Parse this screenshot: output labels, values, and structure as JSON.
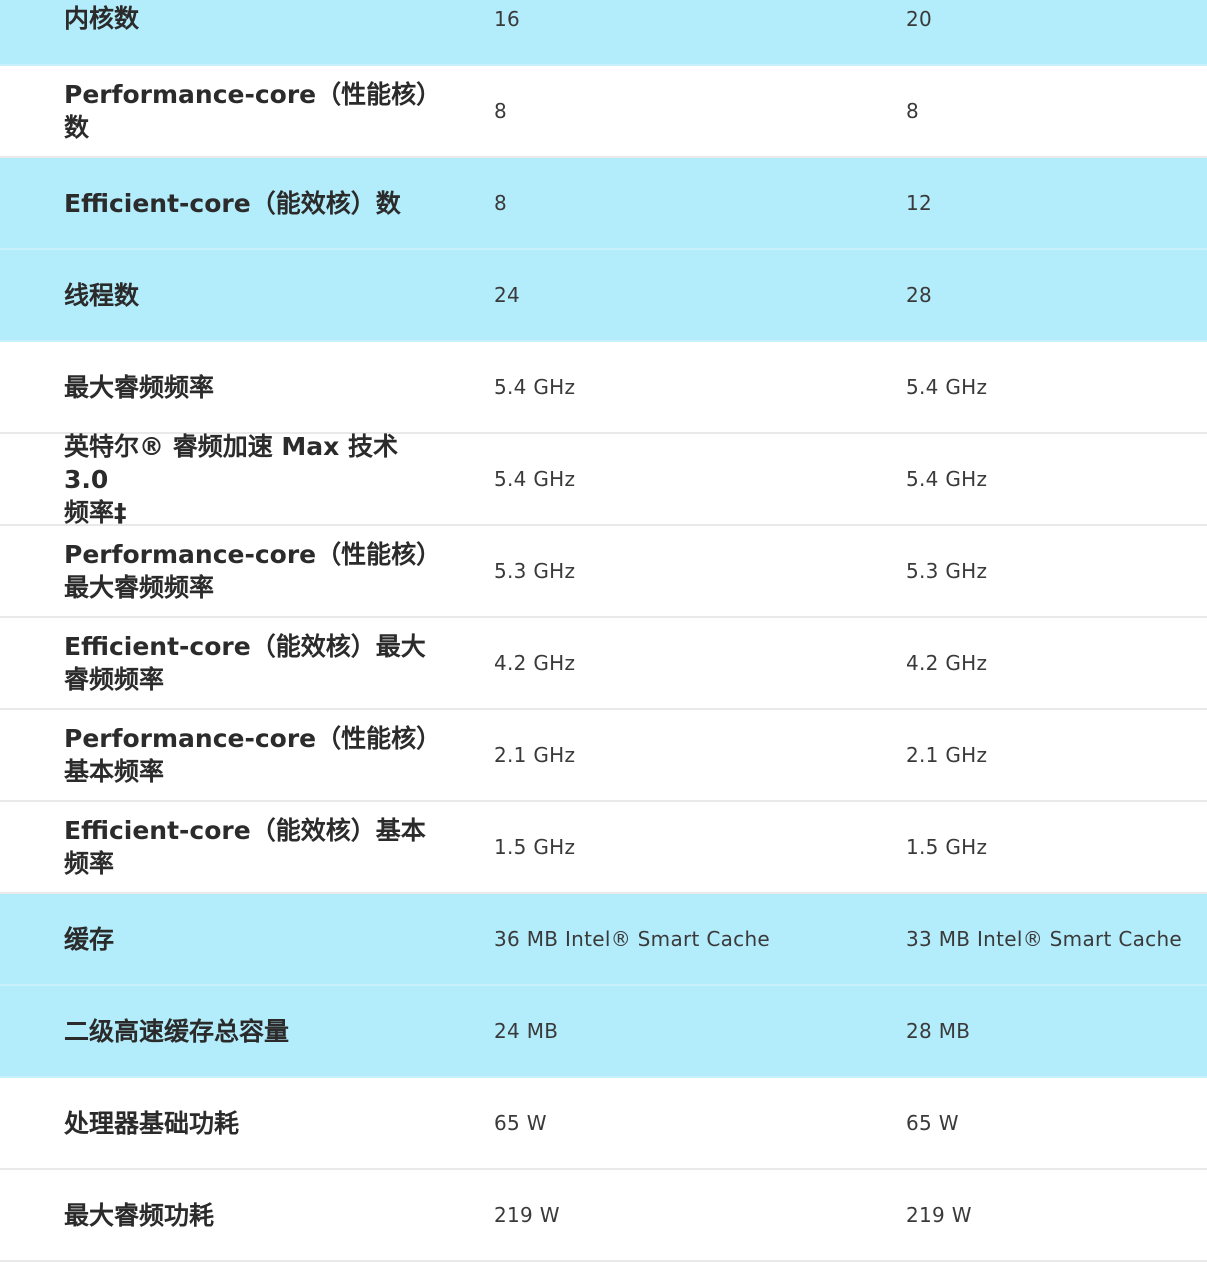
{
  "spec_table": {
    "rows": [
      {
        "label": "内核数",
        "v1": "16",
        "v2": "20",
        "highlight": true
      },
      {
        "label": "Performance-core（性能核）\n数",
        "v1": "8",
        "v2": "8",
        "highlight": false
      },
      {
        "label": "Efficient-core（能效核）数",
        "v1": "8",
        "v2": "12",
        "highlight": true
      },
      {
        "label": "线程数",
        "v1": "24",
        "v2": "28",
        "highlight": true
      },
      {
        "label": "最大睿频频率",
        "v1": "5.4 GHz",
        "v2": "5.4 GHz",
        "highlight": false
      },
      {
        "label": "英特尔® 睿频加速 Max 技术 3.0\n频率‡",
        "v1": "5.4 GHz",
        "v2": "5.4 GHz",
        "highlight": false
      },
      {
        "label": "Performance-core（性能核）\n最大睿频频率",
        "v1": "5.3 GHz",
        "v2": "5.3 GHz",
        "highlight": false
      },
      {
        "label": "Efficient-core（能效核）最大\n睿频频率",
        "v1": "4.2 GHz",
        "v2": "4.2 GHz",
        "highlight": false
      },
      {
        "label": "Performance-core（性能核）\n基本频率",
        "v1": "2.1 GHz",
        "v2": "2.1 GHz",
        "highlight": false
      },
      {
        "label": "Efficient-core（能效核）基本\n频率",
        "v1": "1.5 GHz",
        "v2": "1.5 GHz",
        "highlight": false
      },
      {
        "label": "缓存",
        "v1": "36 MB Intel® Smart Cache",
        "v2": "33 MB Intel® Smart Cache",
        "highlight": true
      },
      {
        "label": "二级高速缓存总容量",
        "v1": "24 MB",
        "v2": "28 MB",
        "highlight": true
      },
      {
        "label": "处理器基础功耗",
        "v1": "65 W",
        "v2": "65 W",
        "highlight": false
      },
      {
        "label": "最大睿频功耗",
        "v1": "219 W",
        "v2": "219 W",
        "highlight": false
      }
    ]
  }
}
